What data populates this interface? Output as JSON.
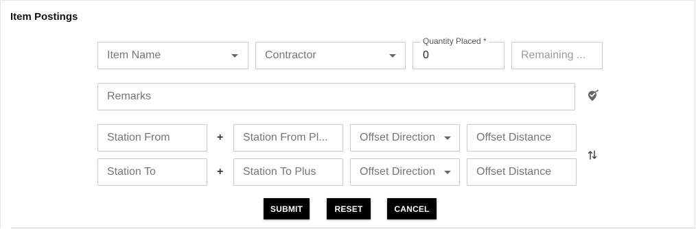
{
  "panel": {
    "title": "Item Postings"
  },
  "fields": {
    "item_name": {
      "placeholder": "Item Name"
    },
    "contractor": {
      "placeholder": "Contractor"
    },
    "quantity_placed": {
      "label": "Quantity Placed *",
      "value": "0"
    },
    "remaining": {
      "placeholder": "Remaining ..."
    },
    "remarks": {
      "placeholder": "Remarks"
    },
    "station_from": {
      "placeholder": "Station From"
    },
    "station_from_plus": {
      "placeholder": "Station From Pl..."
    },
    "offset_direction_from": {
      "placeholder": "Offset Direction"
    },
    "offset_distance_from": {
      "placeholder": "Offset Distance"
    },
    "station_to": {
      "placeholder": "Station To"
    },
    "station_to_plus": {
      "placeholder": "Station To Plus"
    },
    "offset_direction_to": {
      "placeholder": "Offset Direction"
    },
    "offset_distance_to": {
      "placeholder": "Offset Distance"
    }
  },
  "symbols": {
    "plus_from": "+",
    "plus_to": "+"
  },
  "buttons": {
    "submit": "SUBMIT",
    "reset": "RESET",
    "cancel": "CANCEL"
  },
  "icons": {
    "remarks_action": "location-check-icon",
    "swap": "swap-vertical-icon"
  }
}
